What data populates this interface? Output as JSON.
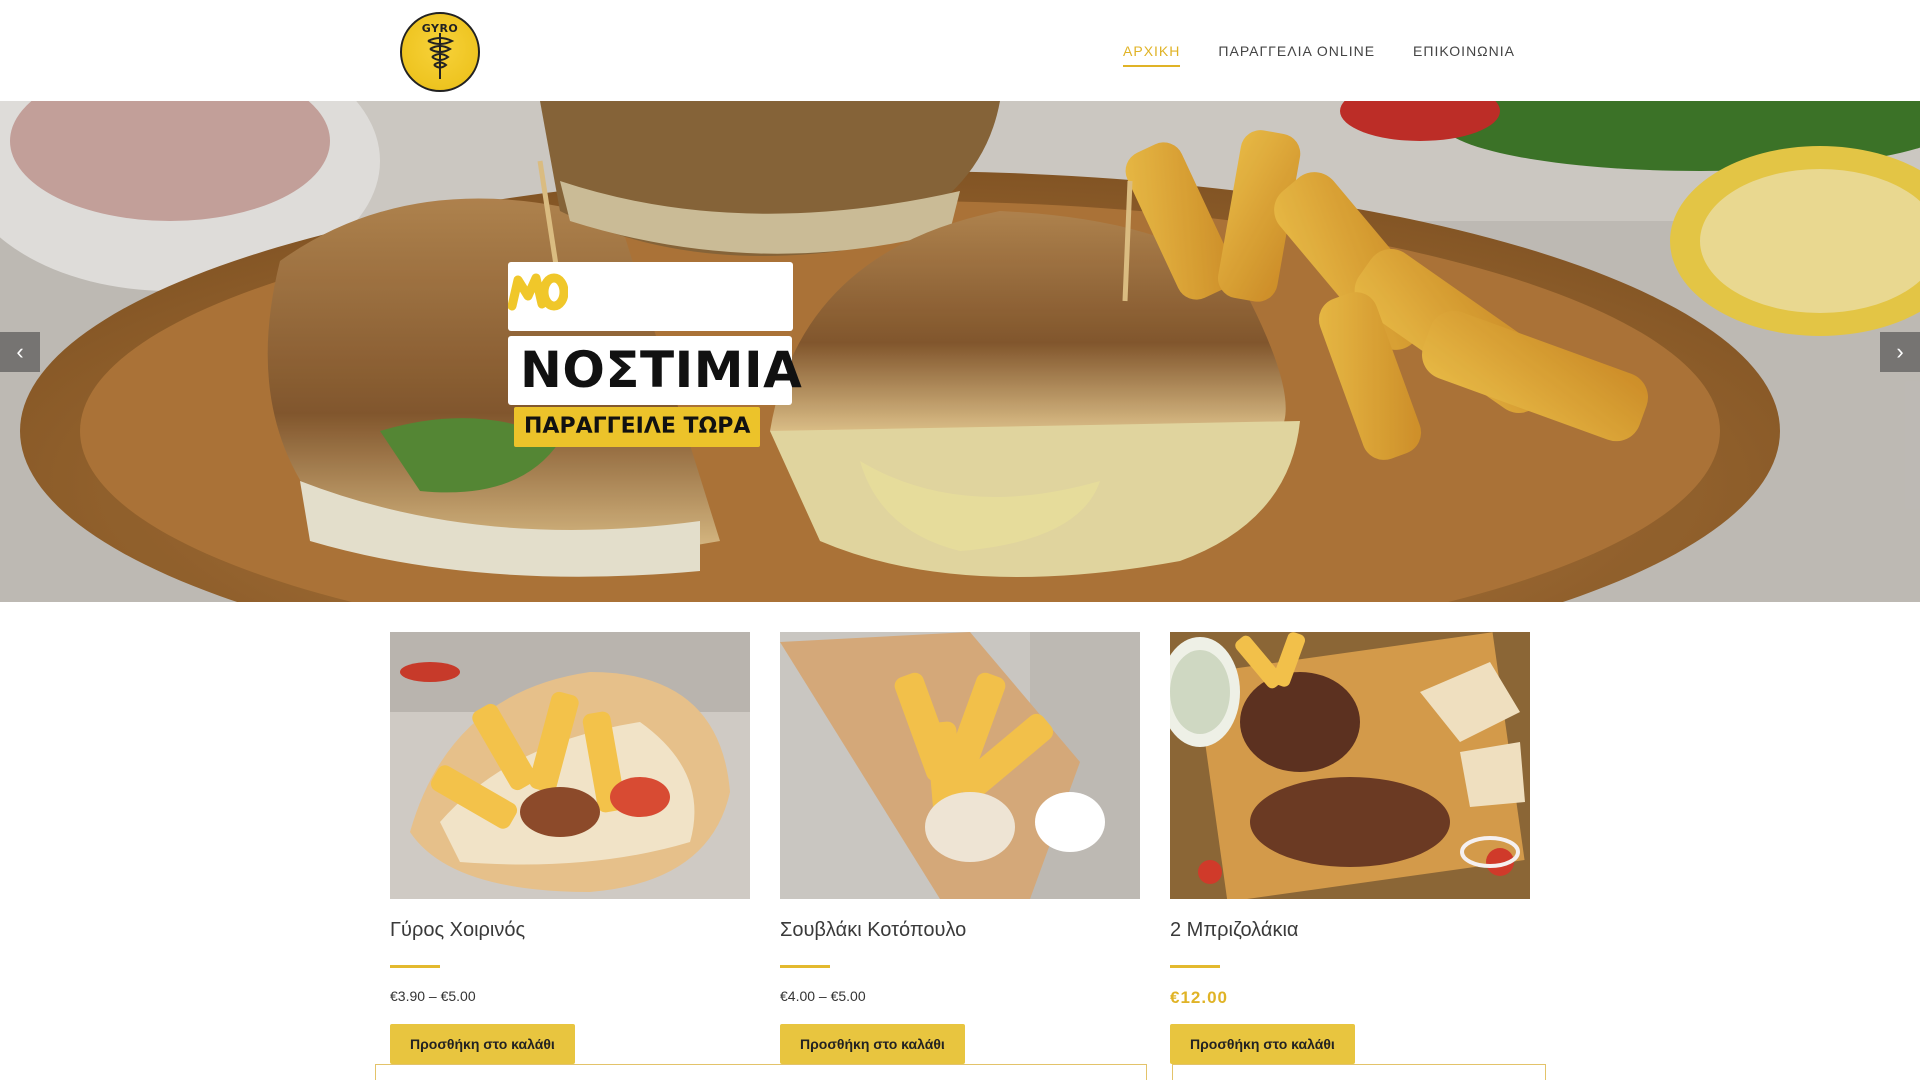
{
  "header": {
    "logo_text": "GYRO",
    "nav": [
      {
        "label": "ΑΡΧΙΚΗ",
        "active": true
      },
      {
        "label": "ΠΑΡΑΓΓΕΛΙΑ ONLINE",
        "active": false
      },
      {
        "label": "ΕΠΙΚΟΙΝΩΝΙΑ",
        "active": false
      }
    ]
  },
  "hero": {
    "tag_text": "ΜΟ",
    "title": "ΝΟΣΤΙΜΙΑ",
    "cta_label": "ΠΑΡΑΓΓΕΙΛΕ ΤΩΡΑ",
    "prev_icon": "chevron-left-icon",
    "next_icon": "chevron-right-icon"
  },
  "products": [
    {
      "name": "Γύρος Χοιρινός",
      "price": "€3.90 – €5.00",
      "button": "Προσθήκη στο καλάθι"
    },
    {
      "name": "Σουβλάκι Κοτόπουλο",
      "price": "€4.00 – €5.00",
      "button": "Προσθήκη στο καλάθι"
    },
    {
      "name": "2 Μπριζολάκια",
      "price": "€12.00",
      "button": "Προσθήκη στο καλάθι"
    }
  ],
  "colors": {
    "accent": "#e0b326",
    "button": "#e8c53f"
  }
}
